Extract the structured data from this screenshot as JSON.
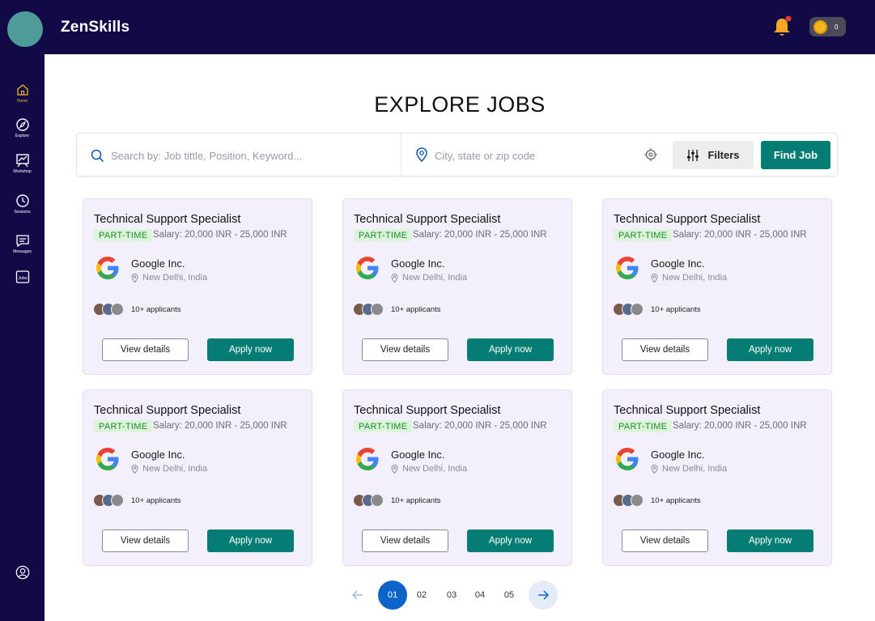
{
  "app": {
    "name": "ZenSkills"
  },
  "header": {
    "coins": "0"
  },
  "sidebar": {
    "items": [
      {
        "label": "Home",
        "icon": "home-icon",
        "active": true
      },
      {
        "label": "Explore",
        "icon": "compass-icon",
        "active": false
      },
      {
        "label": "Workshop",
        "icon": "workshop-icon",
        "active": false
      },
      {
        "label": "Sessions",
        "icon": "clock-icon",
        "active": false
      },
      {
        "label": "Messages",
        "icon": "message-icon",
        "active": false
      },
      {
        "label": "",
        "icon": "jobs-icon",
        "active": false
      }
    ],
    "jobs_icon_text": "Jobs"
  },
  "main": {
    "title": "EXPLORE JOBS",
    "search": {
      "keyword_placeholder": "Search by: Job tittle, Position, Keyword...",
      "location_placeholder": "City, state or zip code",
      "filters_label": "Filters",
      "find_label": "Find Job"
    },
    "jobs": [
      {
        "title": "Technical Support Specialist",
        "type": "PART-TIME",
        "salary": "Salary: 20,000 INR - 25,000 INR",
        "company": "Google Inc.",
        "location": "New Delhi, India",
        "applicants": "10+ applicants",
        "details_label": "View details",
        "apply_label": "Apply now"
      },
      {
        "title": "Technical Support Specialist",
        "type": "PART-TIME",
        "salary": "Salary: 20,000 INR - 25,000 INR",
        "company": "Google Inc.",
        "location": "New Delhi, India",
        "applicants": "10+ applicants",
        "details_label": "View details",
        "apply_label": "Apply now"
      },
      {
        "title": "Technical Support Specialist",
        "type": "PART-TIME",
        "salary": "Salary: 20,000 INR - 25,000 INR",
        "company": "Google Inc.",
        "location": "New Delhi, India",
        "applicants": "10+ applicants",
        "details_label": "View details",
        "apply_label": "Apply now"
      },
      {
        "title": "Technical Support Specialist",
        "type": "PART-TIME",
        "salary": "Salary: 20,000 INR - 25,000 INR",
        "company": "Google Inc.",
        "location": "New Delhi, India",
        "applicants": "10+ applicants",
        "details_label": "View details",
        "apply_label": "Apply now"
      },
      {
        "title": "Technical Support Specialist",
        "type": "PART-TIME",
        "salary": "Salary: 20,000 INR - 25,000 INR",
        "company": "Google Inc.",
        "location": "New Delhi, India",
        "applicants": "10+ applicants",
        "details_label": "View details",
        "apply_label": "Apply now"
      },
      {
        "title": "Technical Support Specialist",
        "type": "PART-TIME",
        "salary": "Salary: 20,000 INR - 25,000 INR",
        "company": "Google Inc.",
        "location": "New Delhi, India",
        "applicants": "10+ applicants",
        "details_label": "View details",
        "apply_label": "Apply now"
      }
    ],
    "pagination": {
      "pages": [
        "01",
        "02",
        "03",
        "04",
        "05"
      ],
      "current": "01"
    }
  },
  "colors": {
    "nav_bg": "#120a47",
    "accent": "#067d74",
    "badge_text": "#1f8a2a",
    "badge_bg": "#dcf3dc",
    "card_bg": "#f4f0fb",
    "page_active": "#0d64c8",
    "active_nav": "#f2b619"
  }
}
